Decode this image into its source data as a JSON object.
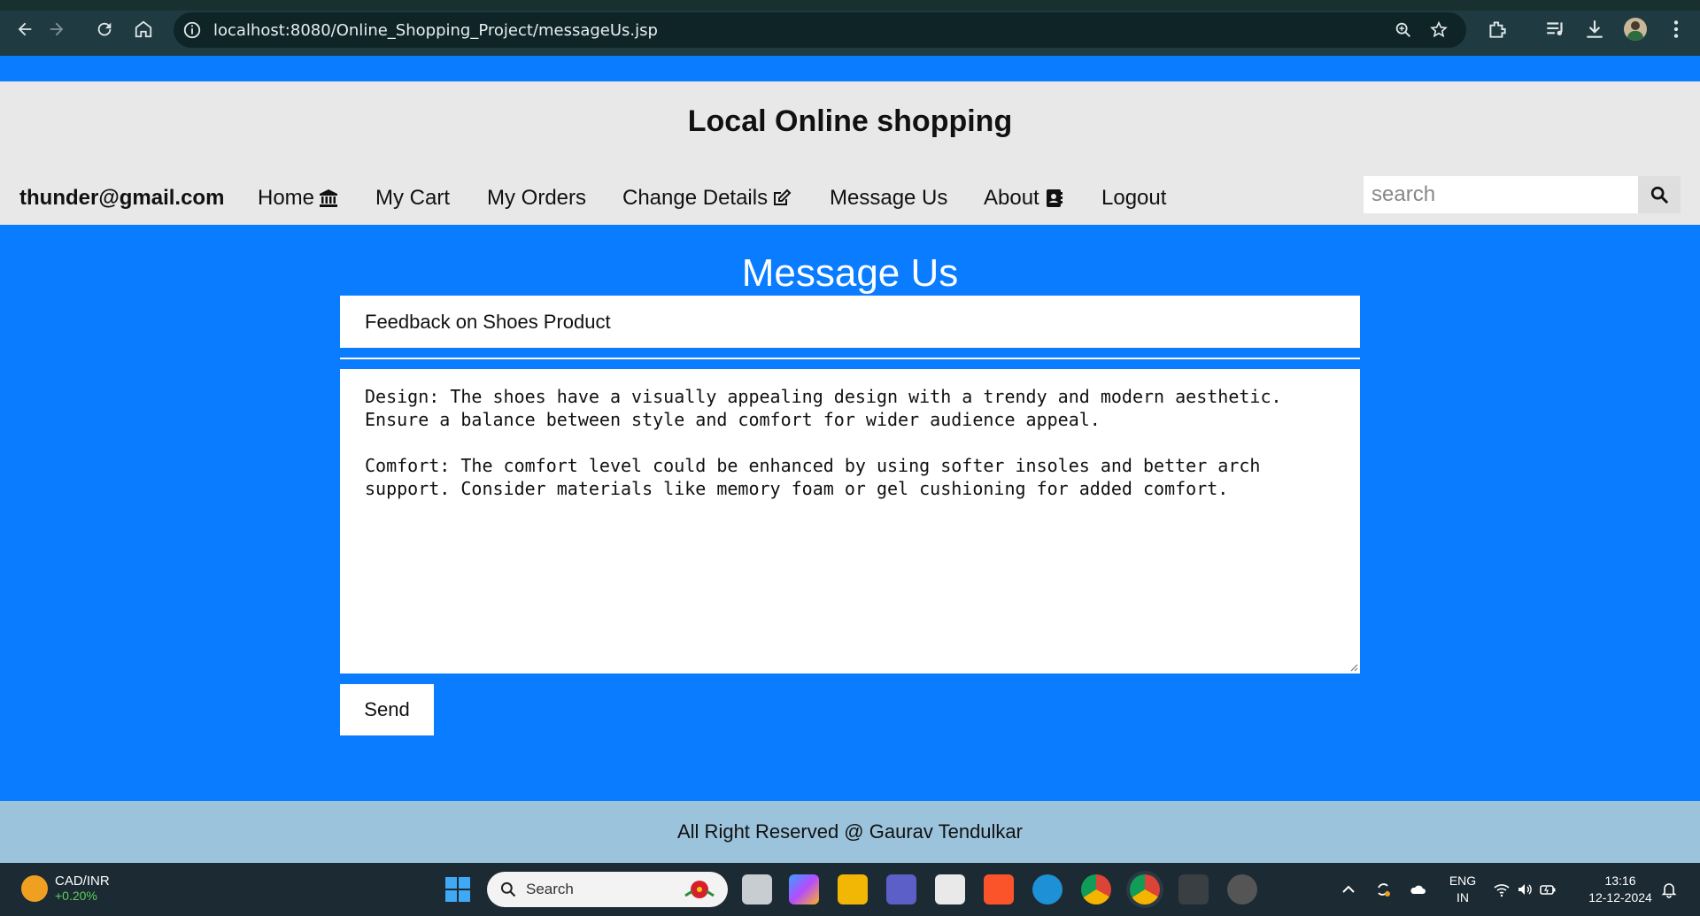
{
  "browser": {
    "url": "localhost:8080/Online_Shopping_Project/messageUs.jsp"
  },
  "site": {
    "title": "Local Online shopping"
  },
  "nav": {
    "user_email": "thunder@gmail.com",
    "items": [
      {
        "label": "Home",
        "icon": "bank-icon"
      },
      {
        "label": "My Cart"
      },
      {
        "label": "My Orders"
      },
      {
        "label": "Change Details",
        "icon": "edit-icon"
      },
      {
        "label": "Message Us"
      },
      {
        "label": "About",
        "icon": "address-book-icon"
      },
      {
        "label": "Logout"
      }
    ],
    "search_placeholder": "search"
  },
  "form": {
    "heading": "Message Us",
    "subject_value": "Feedback on Shoes Product",
    "message_value": "Design: The shoes have a visually appealing design with a trendy and modern aesthetic.\nEnsure a balance between style and comfort for wider audience appeal.\n\nComfort: The comfort level could be enhanced by using softer insoles and better arch\nsupport. Consider materials like memory foam or gel cushioning for added comfort.",
    "send_label": "Send"
  },
  "footer": {
    "text": "All Right Reserved @ Gaurav Tendulkar"
  },
  "taskbar": {
    "widget_title": "CAD/INR",
    "widget_change": "+0.20%",
    "search_label": "Search",
    "lang_line1": "ENG",
    "lang_line2": "IN",
    "time": "13:16",
    "date": "12-12-2024"
  },
  "colors": {
    "page_blue": "#0a7cff",
    "header_grey": "#e8e8e8",
    "footer_blue": "#9cc3dc",
    "chrome_dark": "#1f3a40"
  }
}
